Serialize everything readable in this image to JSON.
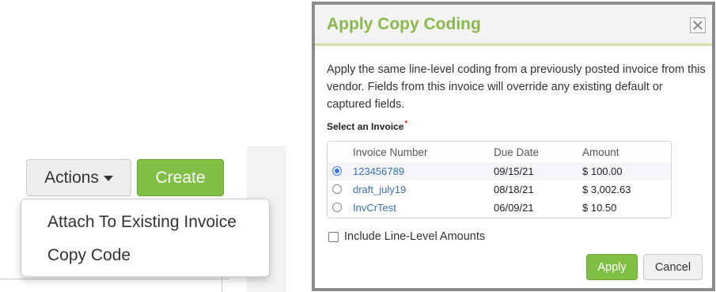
{
  "toolbar": {
    "actions_label": "Actions",
    "create_label": "Create"
  },
  "actions_menu": {
    "items": [
      {
        "label": "Attach To Existing Invoice"
      },
      {
        "label": "Copy Code"
      }
    ]
  },
  "modal": {
    "title": "Apply Copy Coding",
    "description": "Apply the same line-level coding from a previously posted invoice from this vendor. Fields from this invoice will override any existing default or captured fields.",
    "select_label": "Select an Invoice",
    "required_mark": "*",
    "table": {
      "headers": [
        "Invoice Number",
        "Due Date",
        "Amount"
      ],
      "rows": [
        {
          "invoice_number": "123456789",
          "due_date": "09/15/21",
          "amount": "$ 100.00",
          "selected": true
        },
        {
          "invoice_number": "draft_july19",
          "due_date": "08/18/21",
          "amount": "$ 3,002.63",
          "selected": false
        },
        {
          "invoice_number": "InvCrTest",
          "due_date": "06/09/21",
          "amount": "$ 10.50",
          "selected": false
        }
      ]
    },
    "include_label": "Include Line-Level Amounts",
    "include_checked": false,
    "apply_label": "Apply",
    "cancel_label": "Cancel"
  },
  "colors": {
    "accent_green": "#7fbf43",
    "title_green": "#8ab84a",
    "link_blue": "#3b6fb6",
    "radio_blue": "#3478f6",
    "required_red": "#e03030"
  }
}
